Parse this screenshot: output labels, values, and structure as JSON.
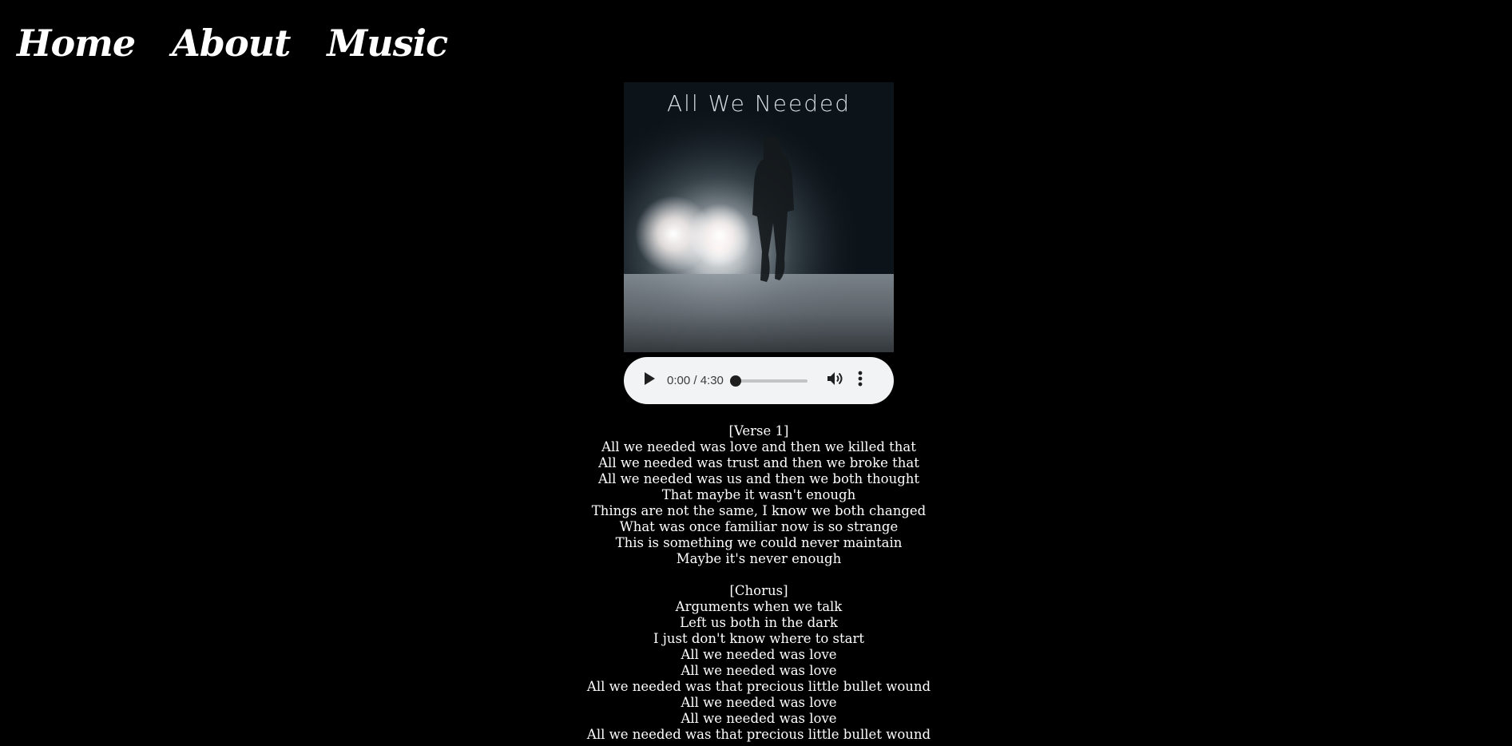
{
  "nav": {
    "items": [
      {
        "label": "Home"
      },
      {
        "label": "About"
      },
      {
        "label": "Music"
      }
    ]
  },
  "cover": {
    "title": "All We Needed"
  },
  "player": {
    "time": "0:00 / 4:30",
    "progress_fraction": 0,
    "icons": {
      "play": "play-icon",
      "volume": "volume-icon",
      "more": "more-vertical-icon"
    }
  },
  "lyrics": {
    "verse1": {
      "header": "[Verse 1]",
      "lines": [
        "All we needed was love and then we killed that",
        "All we needed was trust and then we broke that",
        "All we needed was us and then we both thought",
        "That maybe it wasn't enough",
        "Things are not the same, I know we both changed",
        "What was once familiar now is so strange",
        "This is something we could never maintain",
        "Maybe it's never enough"
      ]
    },
    "chorus": {
      "header": "[Chorus]",
      "lines": [
        "Arguments when we talk",
        "Left us both in the dark",
        "I just don't know where to start",
        "All we needed was love",
        "All we needed was love",
        "All we needed was that precious little bullet wound",
        "All we needed was love",
        "All we needed was love",
        "All we needed was that precious little bullet wound"
      ]
    }
  },
  "colors": {
    "background": "#000000",
    "text": "#ffffff",
    "player_bg": "#f1f3f4"
  }
}
